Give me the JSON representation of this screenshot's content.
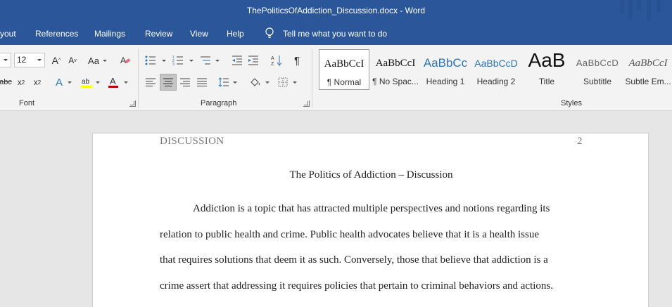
{
  "window": {
    "title": "ThePoliticsOfAddiction_Discussion.docx  -  Word"
  },
  "menu": {
    "tabs": [
      "yout",
      "References",
      "Mailings",
      "Review",
      "View",
      "Help"
    ],
    "tell_me": "Tell me what you want to do"
  },
  "ribbon": {
    "font": {
      "size": "12",
      "group_label": "Font"
    },
    "paragraph": {
      "group_label": "Paragraph"
    },
    "styles": {
      "group_label": "Styles",
      "items": [
        {
          "sample": "AaBbCcI",
          "name": "¶ Normal",
          "selected": true
        },
        {
          "sample": "AaBbCcI",
          "name": "¶ No Spac..."
        },
        {
          "sample": "AaBbCc",
          "name": "Heading 1"
        },
        {
          "sample": "AaBbCcD",
          "name": "Heading 2"
        },
        {
          "sample": "AaB",
          "name": "Title"
        },
        {
          "sample": "AaBbCcD",
          "name": "Subtitle"
        },
        {
          "sample": "AaBbCcI",
          "name": "Subtle Em..."
        }
      ]
    },
    "font_color_accent": "#c00000",
    "highlight_accent": "#ffff00"
  },
  "document": {
    "header_left": "DISCUSSION",
    "page_number": "2",
    "title": "The Politics of Addiction – Discussion",
    "lines": [
      "Addiction is a topic that has attracted multiple perspectives and notions regarding its",
      "relation to public health and crime. Public health advocates believe that it is a health issue",
      "that requires solutions that deem it as such. Conversely, those that believe that addiction is a",
      "crime assert that addressing it requires policies that pertain to criminal behaviors and actions."
    ]
  },
  "colors": {
    "title_bar": "#2b579a",
    "ribbon_bg": "#f3f3f3",
    "doc_bg": "#e6e6e6"
  }
}
